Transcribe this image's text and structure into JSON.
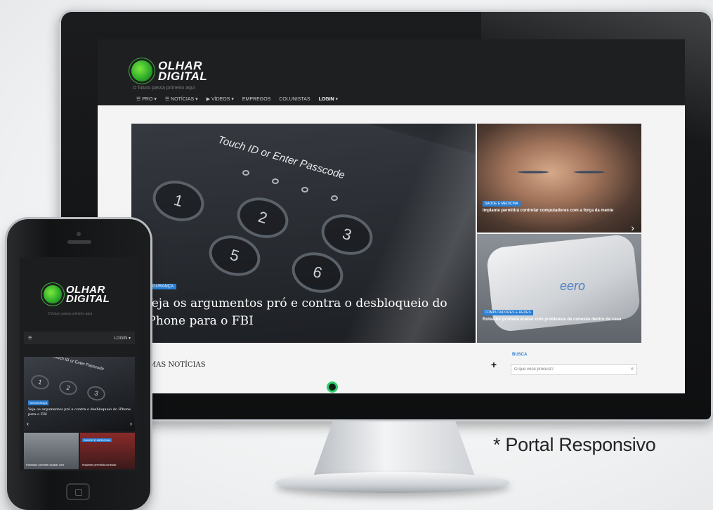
{
  "site": {
    "logo_line1": "OLHAR",
    "logo_line2": "DIGITAL",
    "tagline": "O futuro passa primeiro aqui"
  },
  "nav": {
    "items": [
      "PRO",
      "NOTÍCIAS",
      "VÍDEOS",
      "EMPREGOS",
      "COLUNISTAS"
    ],
    "login": "LOGIN"
  },
  "hero": {
    "screen_text": "Touch ID or Enter Passcode",
    "keys": [
      "1",
      "2",
      "3",
      "5",
      "6"
    ],
    "tag": "SEGURANÇA",
    "headline": "Veja os argumentos pró e contra o desbloqueio do iPhone para o FBI"
  },
  "side_stories": [
    {
      "tag": "SAÚDE E MEDICINA",
      "title": "Implante permitirá controlar computadores com a força da mente"
    },
    {
      "tag": "COMPUTADORES E REDES",
      "title": "Roteador promete acabar com problemas de conexão dentro de casa",
      "device_brand": "eero"
    }
  ],
  "latest": {
    "label": "ÚLTIMAS NOTÍCIAS",
    "plus": "+"
  },
  "search": {
    "label": "BUSCA",
    "placeholder": "O que você procura?"
  },
  "phone": {
    "login": "LOGIN",
    "hero_tag": "SEGURANÇA",
    "hero_title": "Veja os argumentos pró e contra o desbloqueio do iPhone para o FBI",
    "thumb_a": "Roteador promete acabar com",
    "thumb_b": "Implante permitirá controlar"
  },
  "caption": "* Portal Responsivo",
  "colors": {
    "accent_green": "#2fd06c",
    "tag_blue": "#2a7fd4"
  }
}
